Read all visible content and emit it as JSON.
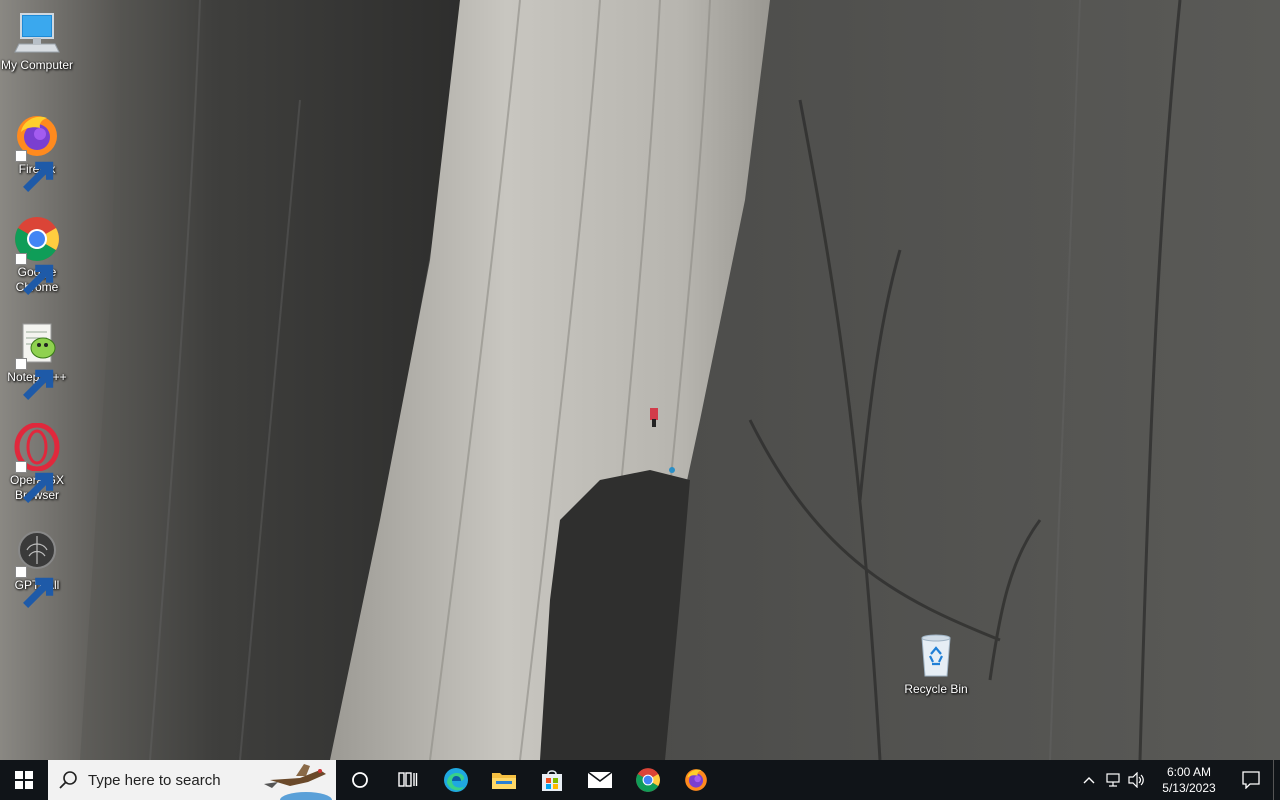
{
  "desktop": {
    "icons": [
      {
        "label": "My Computer",
        "icon": "computer-icon"
      },
      {
        "label": "Firefox",
        "icon": "firefox-icon"
      },
      {
        "label": "Google Chrome",
        "icon": "chrome-icon"
      },
      {
        "label": "Notepad++",
        "icon": "notepadpp-icon"
      },
      {
        "label": "Opera GX Browser",
        "icon": "opera-gx-icon"
      },
      {
        "label": "GPT4All",
        "icon": "gpt4all-icon"
      },
      {
        "label": "Recycle Bin",
        "icon": "recycle-bin-icon"
      }
    ]
  },
  "taskbar": {
    "search_placeholder": "Type here to search",
    "pinned": [
      {
        "name": "cortana",
        "icon": "cortana-icon"
      },
      {
        "name": "task-view",
        "icon": "task-view-icon"
      },
      {
        "name": "edge",
        "icon": "edge-icon"
      },
      {
        "name": "file-explorer",
        "icon": "folder-icon"
      },
      {
        "name": "microsoft-store",
        "icon": "store-icon"
      },
      {
        "name": "mail",
        "icon": "mail-icon"
      },
      {
        "name": "chrome",
        "icon": "chrome-icon"
      },
      {
        "name": "firefox",
        "icon": "firefox-icon"
      }
    ],
    "tray": {
      "time": "6:00 AM",
      "date": "5/13/2023"
    }
  },
  "colors": {
    "taskbar_bg": "#101418",
    "search_bg": "#f2f2f2",
    "windows_blue": "#0078d7"
  }
}
